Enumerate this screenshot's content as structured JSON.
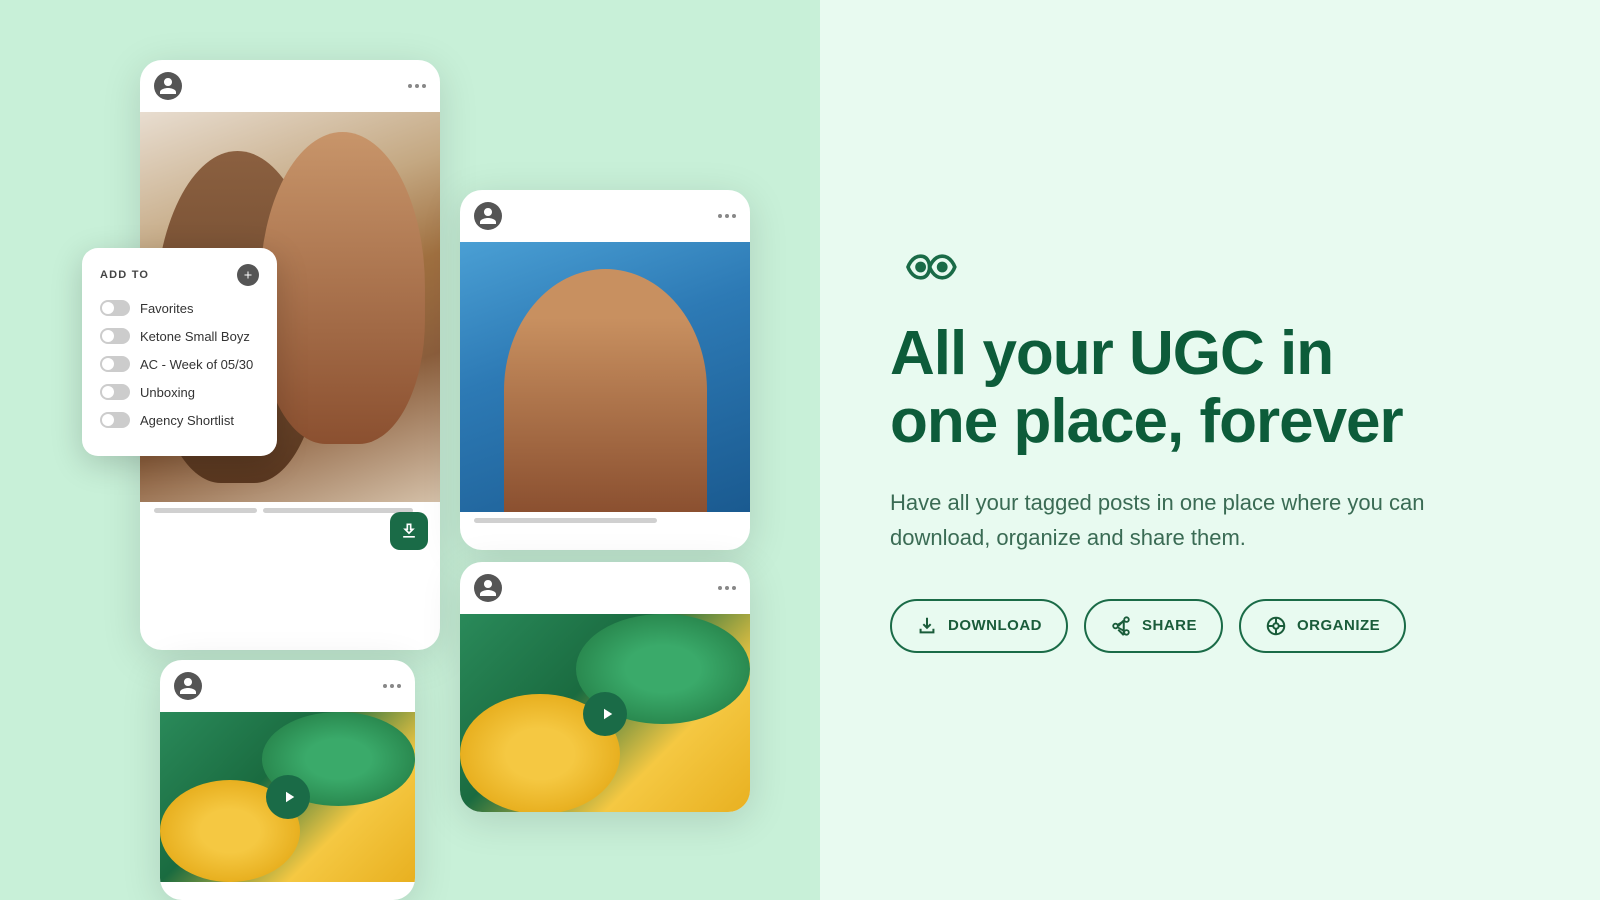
{
  "brand": {
    "logo_alt": "Infinity logo"
  },
  "heading": {
    "main": "All your UGC in one place, forever",
    "sub": "Have all your tagged posts in one place where you can download, organize and share them."
  },
  "buttons": {
    "download": "DOWNLOAD",
    "share": "SHARE",
    "organize": "ORGANIZE"
  },
  "add_to": {
    "label": "ADD TO",
    "items": [
      {
        "id": 1,
        "name": "Favorites",
        "active": false
      },
      {
        "id": 2,
        "name": "Ketone Small Boyz",
        "active": false
      },
      {
        "id": 3,
        "name": "AC - Week of 05/30",
        "active": false
      },
      {
        "id": 4,
        "name": "Unboxing",
        "active": false
      },
      {
        "id": 5,
        "name": "Agency Shortlist",
        "active": false
      }
    ]
  },
  "colors": {
    "brand_green": "#1a6b47",
    "dark_green": "#0d5c3a",
    "bg_left": "#c8f0d8",
    "bg_right": "#e8faf0"
  }
}
